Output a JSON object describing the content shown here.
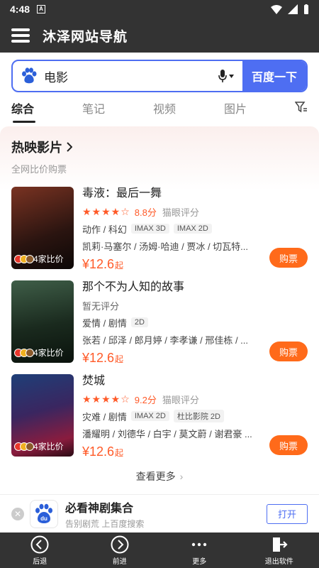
{
  "status": {
    "time": "4:48"
  },
  "app": {
    "title": "沐泽网站导航"
  },
  "search": {
    "value": "电影",
    "button": "百度一下"
  },
  "tabs": [
    {
      "label": "综合",
      "active": true
    },
    {
      "label": "笔记",
      "active": false
    },
    {
      "label": "视频",
      "active": false
    },
    {
      "label": "图片",
      "active": false
    }
  ],
  "section": {
    "title": "热映影片",
    "subtitle": "全网比价购票"
  },
  "movies": [
    {
      "title": "毒液：最后一舞",
      "stars": "★★★★☆",
      "score": "8.8分",
      "score_source": "猫眼评分",
      "genre": "动作 / 科幻",
      "tags": [
        "IMAX 3D",
        "IMAX 2D"
      ],
      "cast": "凯莉·马塞尔 / 汤姆·哈迪 / 贾冰 / 切瓦特...",
      "compare": "4家比价",
      "price": "¥12.6",
      "price_suffix": "起",
      "buy": "购票",
      "poster_colors": [
        "#6b2a1f",
        "#1a0f0c"
      ]
    },
    {
      "title": "那个不为人知的故事",
      "no_rating": "暂无评分",
      "genre": "爱情 / 剧情",
      "tags": [
        "2D"
      ],
      "cast": "张若 / 邱泽 / 郎月婷 / 李孝谦 / 邢佳栋 / ...",
      "compare": "4家比价",
      "price": "¥12.6",
      "price_suffix": "起",
      "buy": "购票",
      "poster_colors": [
        "#2f4a38",
        "#0e1a12"
      ]
    },
    {
      "title": "焚城",
      "stars": "★★★★☆",
      "score": "9.2分",
      "score_source": "猫眼评分",
      "genre": "灾难 / 剧情",
      "tags": [
        "IMAX 2D",
        "杜比影院 2D"
      ],
      "cast": "潘耀明 / 刘德华 / 白宇 / 莫文蔚 / 谢君豪 ...",
      "compare": "4家比价",
      "price": "¥12.6",
      "price_suffix": "起",
      "buy": "购票",
      "poster_colors": [
        "#1b3a6b",
        "#7a1a3a"
      ]
    }
  ],
  "more": "查看更多",
  "ad": {
    "title": "必看神剧集合",
    "subtitle": "告别剧荒 上百度搜索",
    "button": "打开",
    "logo_text": "du"
  },
  "bottom_nav": [
    {
      "label": "后退",
      "icon": "back-icon"
    },
    {
      "label": "前进",
      "icon": "forward-icon"
    },
    {
      "label": "更多",
      "icon": "more-icon"
    },
    {
      "label": "退出软件",
      "icon": "exit-icon"
    }
  ],
  "colors": {
    "accent": "#4e6ef2",
    "orange": "#ff6a1a",
    "dark": "#333333"
  }
}
